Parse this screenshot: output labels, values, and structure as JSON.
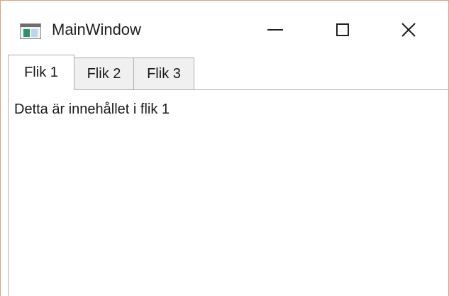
{
  "window": {
    "title": "MainWindow",
    "accent_border_color": "#e0a080"
  },
  "titlebar": {
    "app_icon": "app-window-icon",
    "minimize_glyph": "—",
    "maximize_icon": "maximize-icon",
    "close_glyph": "✕"
  },
  "tabs": [
    {
      "label": "Flik 1",
      "selected": true
    },
    {
      "label": "Flik 2",
      "selected": false
    },
    {
      "label": "Flik 3",
      "selected": false
    }
  ],
  "content": {
    "text": "Detta är innehållet i flik 1"
  }
}
